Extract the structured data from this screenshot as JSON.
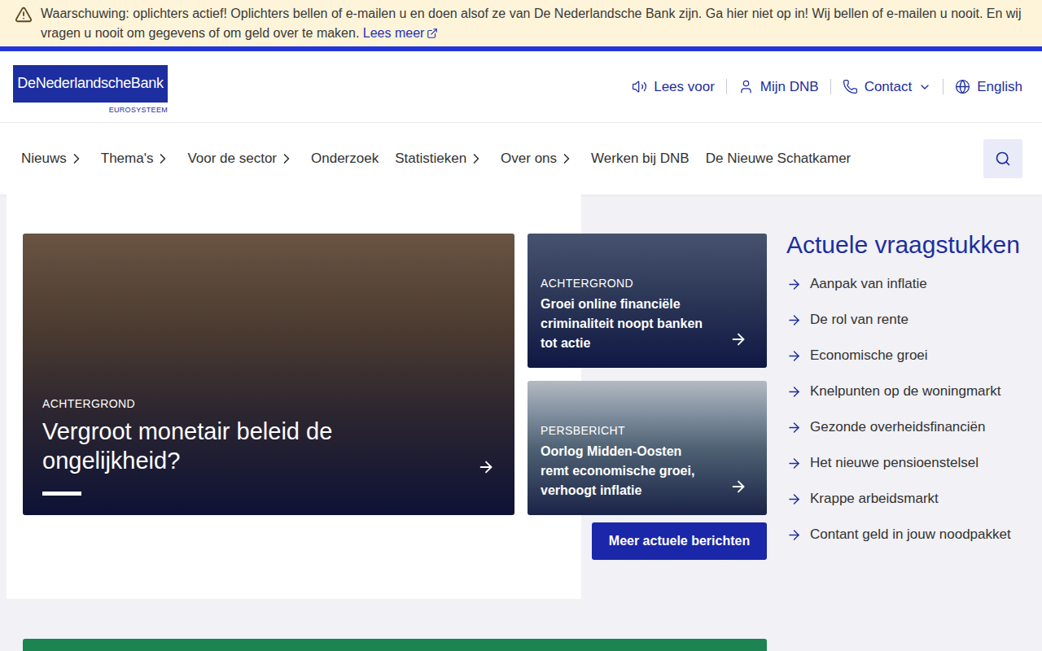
{
  "warning": {
    "text": "Waarschuwing: oplichters actief! Oplichters bellen of e-mailen u en doen alsof ze van De Nederlandsche Bank zijn. Ga hier niet op in! Wij bellen of e-mailen u nooit. En wij vragen u nooit om gegevens of om geld over te maken.",
    "link": "Lees meer"
  },
  "logo": {
    "name": "DeNederlandscheBank",
    "sub": "EUROSYSTEEM"
  },
  "utility": [
    {
      "label": "Lees voor",
      "dropdown": false
    },
    {
      "label": "Mijn DNB",
      "dropdown": false
    },
    {
      "label": "Contact",
      "dropdown": true
    },
    {
      "label": "English",
      "dropdown": false
    }
  ],
  "nav": [
    {
      "label": "Nieuws",
      "submenu": true
    },
    {
      "label": "Thema's",
      "submenu": true
    },
    {
      "label": "Voor de sector",
      "submenu": true
    },
    {
      "label": "Onderzoek",
      "submenu": false
    },
    {
      "label": "Statistieken",
      "submenu": true
    },
    {
      "label": "Over ons",
      "submenu": true
    },
    {
      "label": "Werken bij DNB",
      "submenu": false
    },
    {
      "label": "De Nieuwe Schatkamer",
      "submenu": false
    }
  ],
  "cards": [
    {
      "kind": "feature",
      "kicker": "ACHTERGROND",
      "title": "Vergroot monetair beleid de ongelijkheid?"
    },
    {
      "kind": "small",
      "kicker": "ACHTERGROND",
      "title": "Groei online financiële criminaliteit noopt banken tot actie"
    },
    {
      "kind": "small",
      "kicker": "PERSBERICHT",
      "title": "Oorlog Midden-Oosten remt economische groei, verhoogt inflatie"
    }
  ],
  "more_button": "Meer actuele berichten",
  "topics": {
    "title": "Actuele vraagstukken",
    "items": [
      "Aanpak van inflatie",
      "De rol van rente",
      "Economische groei",
      "Knelpunten op de woningmarkt",
      "Gezonde overheidsfinanciën",
      "Het nieuwe pensioenstelsel",
      "Krappe arbeidsmarkt",
      "Contant geld in jouw noodpakket"
    ]
  }
}
